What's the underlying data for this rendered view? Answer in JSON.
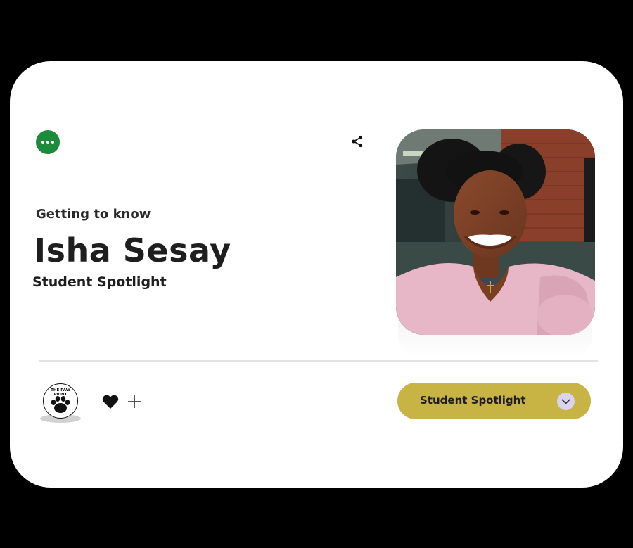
{
  "header": {
    "eyebrow": "Getting to know",
    "name": "Isha Sesay",
    "subtitle": "Student Spotlight"
  },
  "publication": {
    "logo_line1": "THE PAW",
    "logo_line2": "PRINT"
  },
  "footer": {
    "category_label": "Student Spotlight"
  },
  "icons": {
    "menu": "more-icon",
    "share": "share-icon",
    "like": "heart-icon",
    "add": "plus-icon",
    "expand": "chevron-down-icon"
  },
  "colors": {
    "page_background": "#000000",
    "card_background": "#ffffff",
    "menu_button": "#1d8a3c",
    "category_pill": "#c8b345",
    "chevron_circle": "#d9d3ee"
  }
}
